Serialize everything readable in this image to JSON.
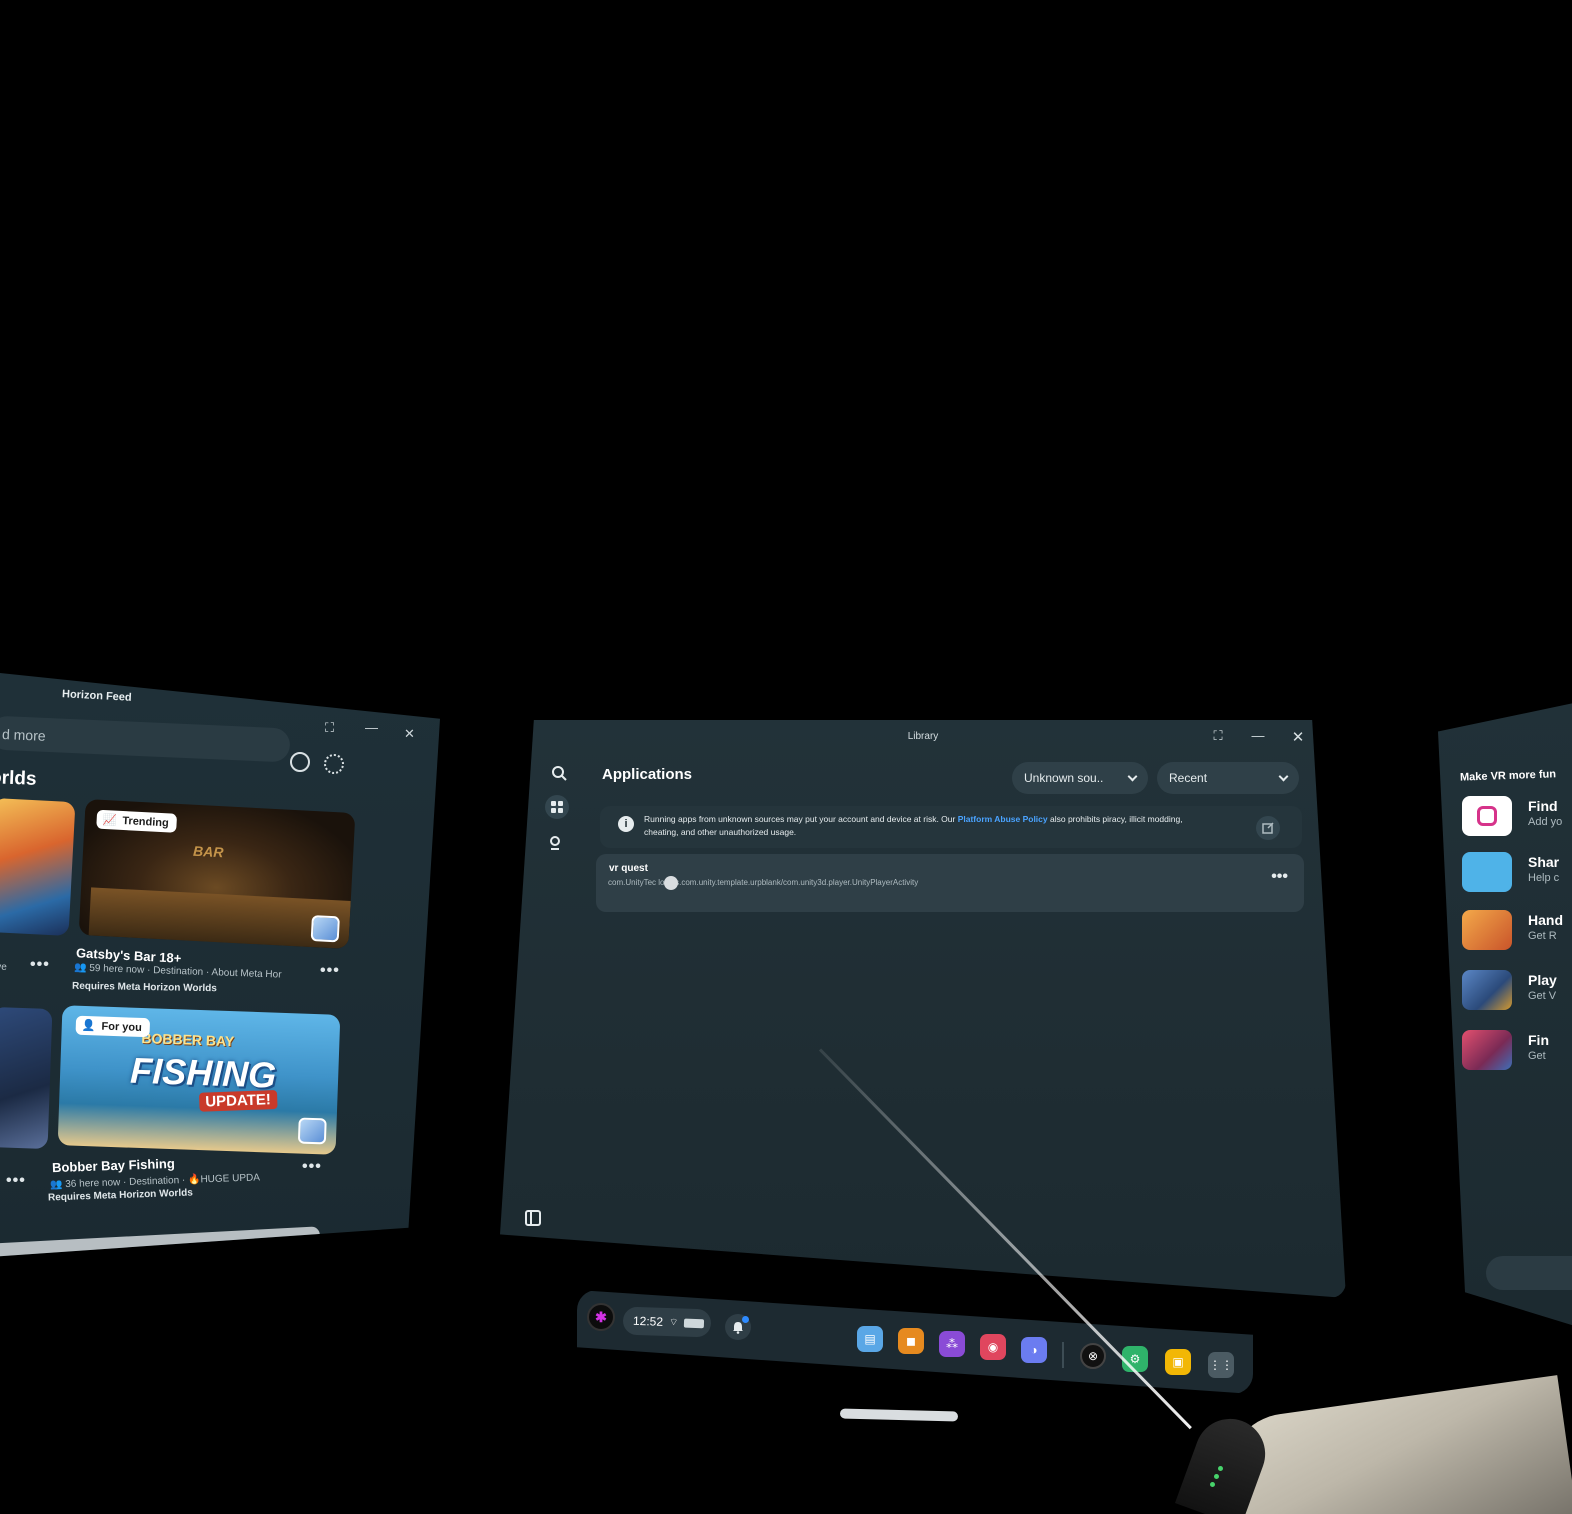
{
  "left_panel": {
    "title": "Horizon Feed",
    "search_placeholder": "d more",
    "section_heading": "orlds",
    "cards": [
      {
        "badge": "Trending",
        "title": "Gatsby's Bar 18+",
        "meta": "59 here now · Destination · About Meta Hor",
        "requirement": "Requires Meta Horizon Worlds",
        "image_text": "BAR"
      },
      {
        "badge": "For you",
        "title": "Bobber Bay Fishing",
        "meta": "36 here now · Destination · 🔥HUGE UPDA",
        "requirement": "Requires Meta Horizon Worlds",
        "image_text": "FISHING",
        "image_sub": "BOBBER BAY",
        "image_update": "UPDATE!"
      }
    ],
    "left_card_meta": "ive",
    "more": "•••"
  },
  "library": {
    "title": "Library",
    "heading": "Applications",
    "filter_source": "Unknown sou..",
    "filter_sort": "Recent",
    "notice_text_before": "Running apps from unknown sources may put your account and device at risk. Our ",
    "notice_link": "Platform Abuse Policy",
    "notice_text_after": " also prohibits piracy, illicit modding, cheating, and other unauthorized usage.",
    "apps": [
      {
        "name": "vr quest",
        "package": "com.UnityTec  logies.com.unity.template.urpblank/com.unity3d.player.UnityPlayerActivity",
        "more": "•••"
      }
    ]
  },
  "right_panel": {
    "heading": "Make VR more fun",
    "items": [
      {
        "title": "Find",
        "sub": "Add yo",
        "color": "#ffffff"
      },
      {
        "title": "Shar",
        "sub": "Help c",
        "color": "#4fb3e8"
      },
      {
        "title": "Hand",
        "sub": "Get R",
        "color": "#e7873a"
      },
      {
        "title": "Play",
        "sub": "Get V",
        "color": "#3a6ea8"
      },
      {
        "title": "Fin",
        "sub": "Get",
        "color": "#c43c64"
      }
    ]
  },
  "taskbar": {
    "time": "12:52",
    "apps": [
      {
        "name": "store",
        "color": "#5aa7e6"
      },
      {
        "name": "shop",
        "color": "#e68a1f"
      },
      {
        "name": "people",
        "color": "#8a4bd6"
      },
      {
        "name": "camera",
        "color": "#e0465e"
      },
      {
        "name": "horizon",
        "color": "#6b7cf0"
      },
      {
        "name": "meta",
        "color": "#111111"
      },
      {
        "name": "settings",
        "color": "#2fb36a"
      },
      {
        "name": "files",
        "color": "#f2b705"
      },
      {
        "name": "all-apps",
        "color": "#4b5b63"
      }
    ]
  },
  "colors": {
    "panel_bg": "#223239",
    "accent_link": "#4aa3ff",
    "row_bg": "#2f3f47"
  }
}
